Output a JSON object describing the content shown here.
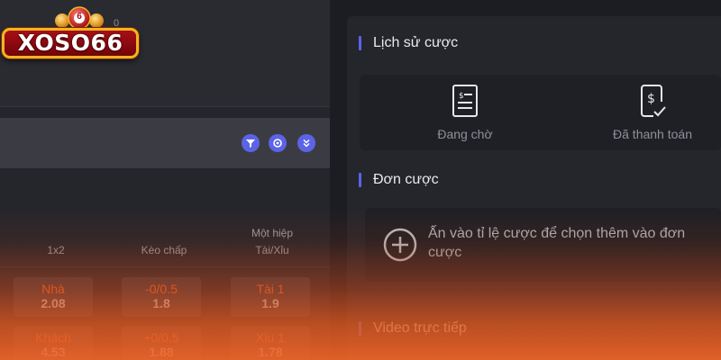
{
  "brand": {
    "logo_text": "XOSO66",
    "ball_number": "6",
    "counter": "0"
  },
  "accent_color": "#5b63e6",
  "odds_color": "#ff6a1c",
  "match_bar": {
    "icons": [
      "filter-icon",
      "settings-icon",
      "expand-icon"
    ]
  },
  "odds_table": {
    "columns": {
      "col1": "1x2",
      "col2": "Kèo chấp",
      "col3_line1": "Một hiệp",
      "col3_line2": "Tài/Xỉu"
    },
    "rows": [
      {
        "c1_label": "Nhà",
        "c1_value": "2.08",
        "c2_label": "-0/0.5",
        "c2_value": "1.8",
        "c3_label": "Tài 1",
        "c3_value": "1.9"
      },
      {
        "c1_label": "Khách",
        "c1_value": "4.53",
        "c2_label": "+0/0.5",
        "c2_value": "1.88",
        "c3_label": "Xỉu 1",
        "c3_value": "1.78"
      }
    ]
  },
  "bet_history": {
    "title": "Lịch sử cược",
    "items": [
      {
        "label": "Đang chờ",
        "icon": "pending-document-icon"
      },
      {
        "label": "Đã thanh toán",
        "icon": "paid-receipt-icon"
      }
    ]
  },
  "bet_slip": {
    "title": "Đơn cược",
    "empty_message": "Ấn vào tỉ lệ cược để chọn thêm vào đơn cược"
  },
  "live_video": {
    "title": "Video trực tiếp"
  }
}
